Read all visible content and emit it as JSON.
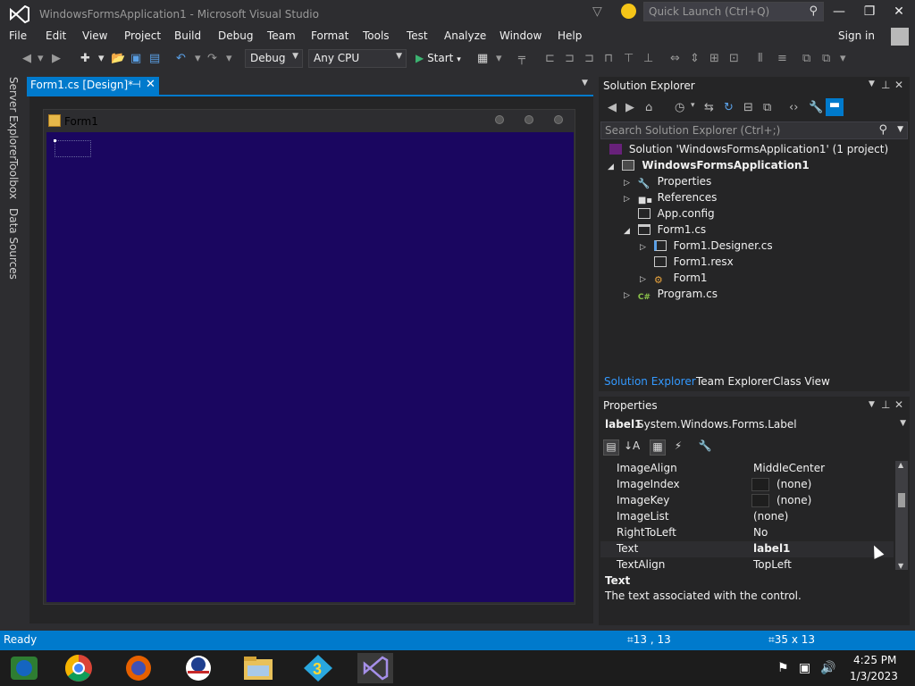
{
  "window": {
    "title": "WindowsFormsApplication1 - Microsoft Visual Studio",
    "quick_launch_placeholder": "Quick Launch (Ctrl+Q)",
    "minimize": "—",
    "restore": "❐",
    "close": "✕"
  },
  "menu": {
    "items": [
      "File",
      "Edit",
      "View",
      "Project",
      "Build",
      "Debug",
      "Team",
      "Format",
      "Tools",
      "Test",
      "Analyze",
      "Window",
      "Help"
    ],
    "sign_in": "Sign in"
  },
  "toolbar": {
    "config": "Debug",
    "platform": "Any CPU",
    "start": "Start"
  },
  "left_dock": {
    "tabs": [
      "Server Explorer",
      "Toolbox",
      "Data Sources"
    ]
  },
  "document": {
    "tab_label": "Form1.cs [Design]*",
    "form_title": "Form1"
  },
  "solution_explorer": {
    "title": "Solution Explorer",
    "search_placeholder": "Search Solution Explorer (Ctrl+;)",
    "tree": [
      {
        "label": "Solution 'WindowsFormsApplication1' (1 project)",
        "expander": "",
        "icon": "solution-icon"
      },
      {
        "label": "WindowsFormsApplication1",
        "expander": "◢",
        "icon": "csharp-project-icon"
      },
      {
        "label": "Properties",
        "expander": "▷",
        "icon": "wrench-icon"
      },
      {
        "label": "References",
        "expander": "▷",
        "icon": "references-icon"
      },
      {
        "label": "App.config",
        "expander": "",
        "icon": "config-file-icon"
      },
      {
        "label": "Form1.cs",
        "expander": "◢",
        "icon": "form-file-icon"
      },
      {
        "label": "Form1.Designer.cs",
        "expander": "▷",
        "icon": "cs-file-icon"
      },
      {
        "label": "Form1.resx",
        "expander": "",
        "icon": "resx-file-icon"
      },
      {
        "label": "Form1",
        "expander": "▷",
        "icon": "class-icon"
      },
      {
        "label": "Program.cs",
        "expander": "▷",
        "icon": "csharp-file-icon"
      }
    ],
    "tabs": [
      "Solution Explorer",
      "Team Explorer",
      "Class View"
    ]
  },
  "properties": {
    "title": "Properties",
    "object_name": "label1",
    "object_type": "System.Windows.Forms.Label",
    "rows": [
      {
        "name": "ImageAlign",
        "value": "MiddleCenter"
      },
      {
        "name": "ImageIndex",
        "value": "(none)"
      },
      {
        "name": "ImageKey",
        "value": "(none)"
      },
      {
        "name": "ImageList",
        "value": "(none)"
      },
      {
        "name": "RightToLeft",
        "value": "No"
      },
      {
        "name": "Text",
        "value": "label1"
      },
      {
        "name": "TextAlign",
        "value": "TopLeft"
      }
    ],
    "desc_title": "Text",
    "desc_text": "The text associated with the control."
  },
  "statusbar": {
    "text": "Ready",
    "position": "13 , 13",
    "size": "35 x 13"
  },
  "taskbar": {
    "time": "4:25 PM",
    "date": "1/3/2023"
  },
  "colors": {
    "accent": "#007acc",
    "form_background": "#1a0660",
    "chrome": "#2d2d30"
  }
}
